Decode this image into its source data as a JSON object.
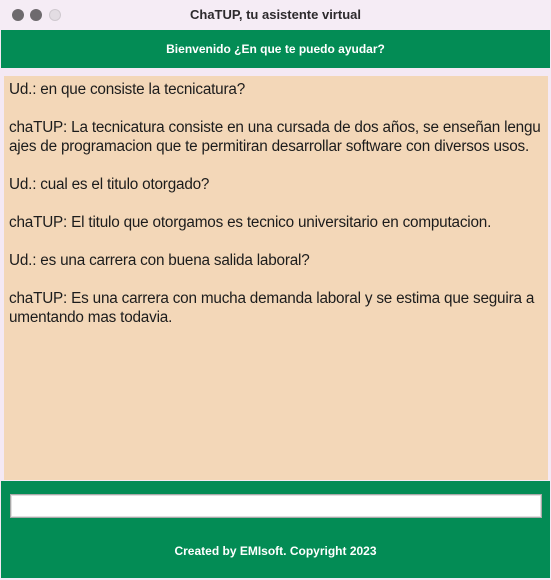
{
  "window": {
    "title": "ChaTUP, tu asistente virtual"
  },
  "header": {
    "text": "Bienvenido ¿En que te puedo ayudar?"
  },
  "chat": {
    "messages": [
      "Ud.: en que consiste la tecnicatura?",
      "chaTUP: La tecnicatura consiste en una cursada de dos años, se enseñan lenguajes de programacion que te permitiran desarrollar software con diversos usos.",
      "Ud.: cual es el titulo otorgado?",
      "chaTUP: El titulo que otorgamos es tecnico universitario en computacion.",
      "Ud.: es una carrera con buena salida laboral?",
      "chaTUP: Es una carrera con mucha demanda laboral y se estima que seguira aumentando mas todavia."
    ]
  },
  "input": {
    "value": "",
    "placeholder": ""
  },
  "footer": {
    "text": "Created by EMIsoft. Copyright 2023"
  },
  "colors": {
    "accent": "#038c55",
    "chat_background": "#f3d7b8",
    "titlebar": "#f5ecf5"
  }
}
